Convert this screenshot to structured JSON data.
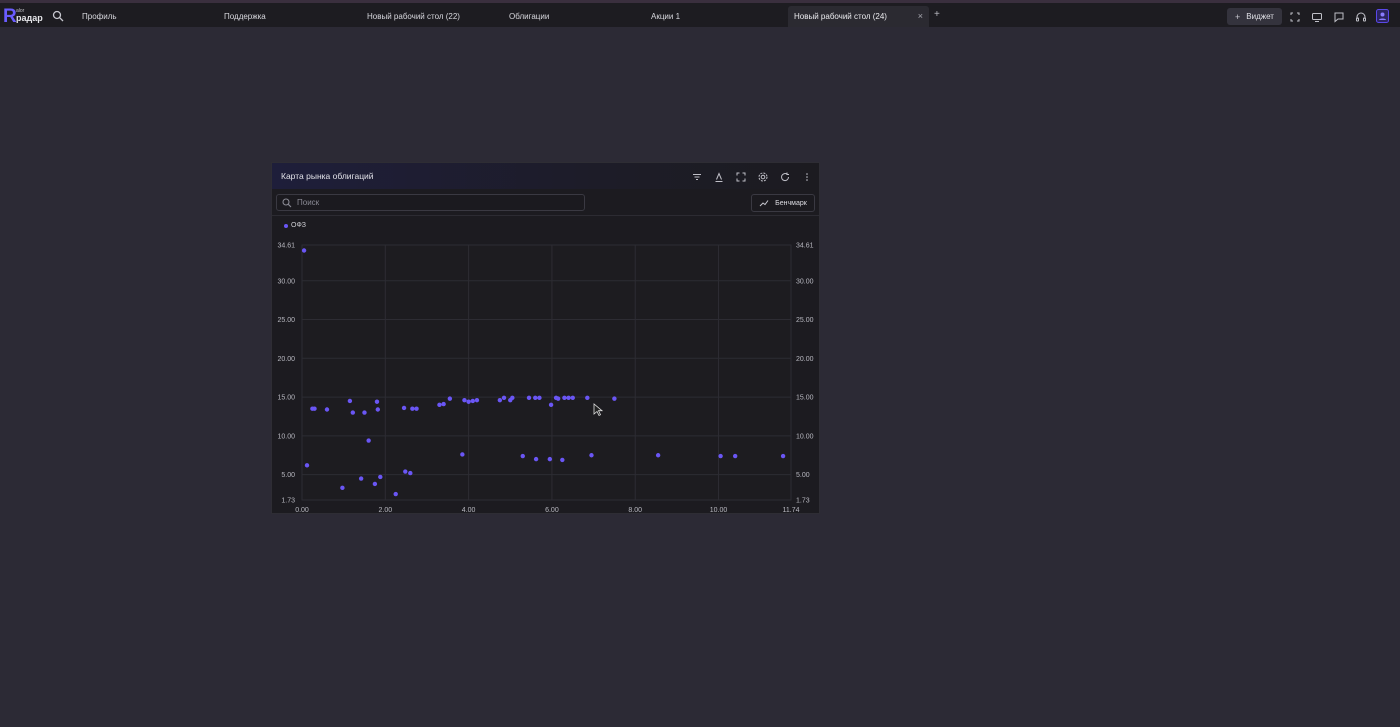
{
  "app": {
    "logo_sub": "alor",
    "logo_name": "радар"
  },
  "tabs": [
    {
      "label": "Профиль"
    },
    {
      "label": "Поддержка"
    },
    {
      "label": "Новый рабочий стол (22)"
    },
    {
      "label": "Облигации"
    },
    {
      "label": "Акции 1"
    },
    {
      "label": "Новый рабочий стол (24)",
      "active": true
    }
  ],
  "toolbar": {
    "add_tab": "+",
    "widget_label": "Виджет",
    "icons": [
      "fullscreen-icon",
      "monitor-icon",
      "chat-icon",
      "headset-icon",
      "profile-icon"
    ]
  },
  "widget": {
    "title": "Карта рынка облигаций",
    "header_icons": [
      "filter-icon",
      "text-format-icon",
      "expand-icon",
      "gear-icon",
      "refresh-icon",
      "more-vert-icon"
    ],
    "search": {
      "placeholder": "Поиск",
      "value": ""
    },
    "benchmark_label": "Бенчмарк",
    "close_symbol": "×"
  },
  "chart_data": {
    "type": "scatter",
    "series": [
      {
        "name": "ОФЗ",
        "color": "#6a56f5",
        "points": [
          [
            0.05,
            33.9
          ],
          [
            0.12,
            6.2
          ],
          [
            0.25,
            13.5
          ],
          [
            0.3,
            13.5
          ],
          [
            0.6,
            13.4
          ],
          [
            0.97,
            3.3
          ],
          [
            1.15,
            14.5
          ],
          [
            1.22,
            13.0
          ],
          [
            1.42,
            4.5
          ],
          [
            1.5,
            13.0
          ],
          [
            1.6,
            9.4
          ],
          [
            1.75,
            3.8
          ],
          [
            1.8,
            14.4
          ],
          [
            1.82,
            13.4
          ],
          [
            1.88,
            4.7
          ],
          [
            2.25,
            2.5
          ],
          [
            2.45,
            13.6
          ],
          [
            2.48,
            5.4
          ],
          [
            2.6,
            5.2
          ],
          [
            2.65,
            13.5
          ],
          [
            2.75,
            13.5
          ],
          [
            3.3,
            14.0
          ],
          [
            3.4,
            14.1
          ],
          [
            3.55,
            14.8
          ],
          [
            3.85,
            7.6
          ],
          [
            3.9,
            14.6
          ],
          [
            4.0,
            14.4
          ],
          [
            4.1,
            14.5
          ],
          [
            4.2,
            14.6
          ],
          [
            4.75,
            14.6
          ],
          [
            4.85,
            14.9
          ],
          [
            5.0,
            14.6
          ],
          [
            5.05,
            14.9
          ],
          [
            5.3,
            7.4
          ],
          [
            5.45,
            14.9
          ],
          [
            5.6,
            14.9
          ],
          [
            5.62,
            7.0
          ],
          [
            5.7,
            14.9
          ],
          [
            5.95,
            7.0
          ],
          [
            5.98,
            14.0
          ],
          [
            6.1,
            14.9
          ],
          [
            6.15,
            14.8
          ],
          [
            6.25,
            6.9
          ],
          [
            6.3,
            14.9
          ],
          [
            6.4,
            14.9
          ],
          [
            6.5,
            14.9
          ],
          [
            6.85,
            14.9
          ],
          [
            6.95,
            7.5
          ],
          [
            7.5,
            14.8
          ],
          [
            8.55,
            7.5
          ],
          [
            10.05,
            7.4
          ],
          [
            10.4,
            7.4
          ],
          [
            11.55,
            7.4
          ]
        ]
      }
    ],
    "x_ticks": [
      "0.00",
      "2.00",
      "4.00",
      "6.00",
      "8.00",
      "10.00",
      "11.74"
    ],
    "y_ticks": [
      "34.61",
      "30.00",
      "25.00",
      "20.00",
      "15.00",
      "10.00",
      "5.00",
      "1.73"
    ],
    "xlim": [
      0,
      11.74
    ],
    "ylim": [
      1.73,
      34.61
    ],
    "grid": true,
    "legend_position": "top-left"
  }
}
